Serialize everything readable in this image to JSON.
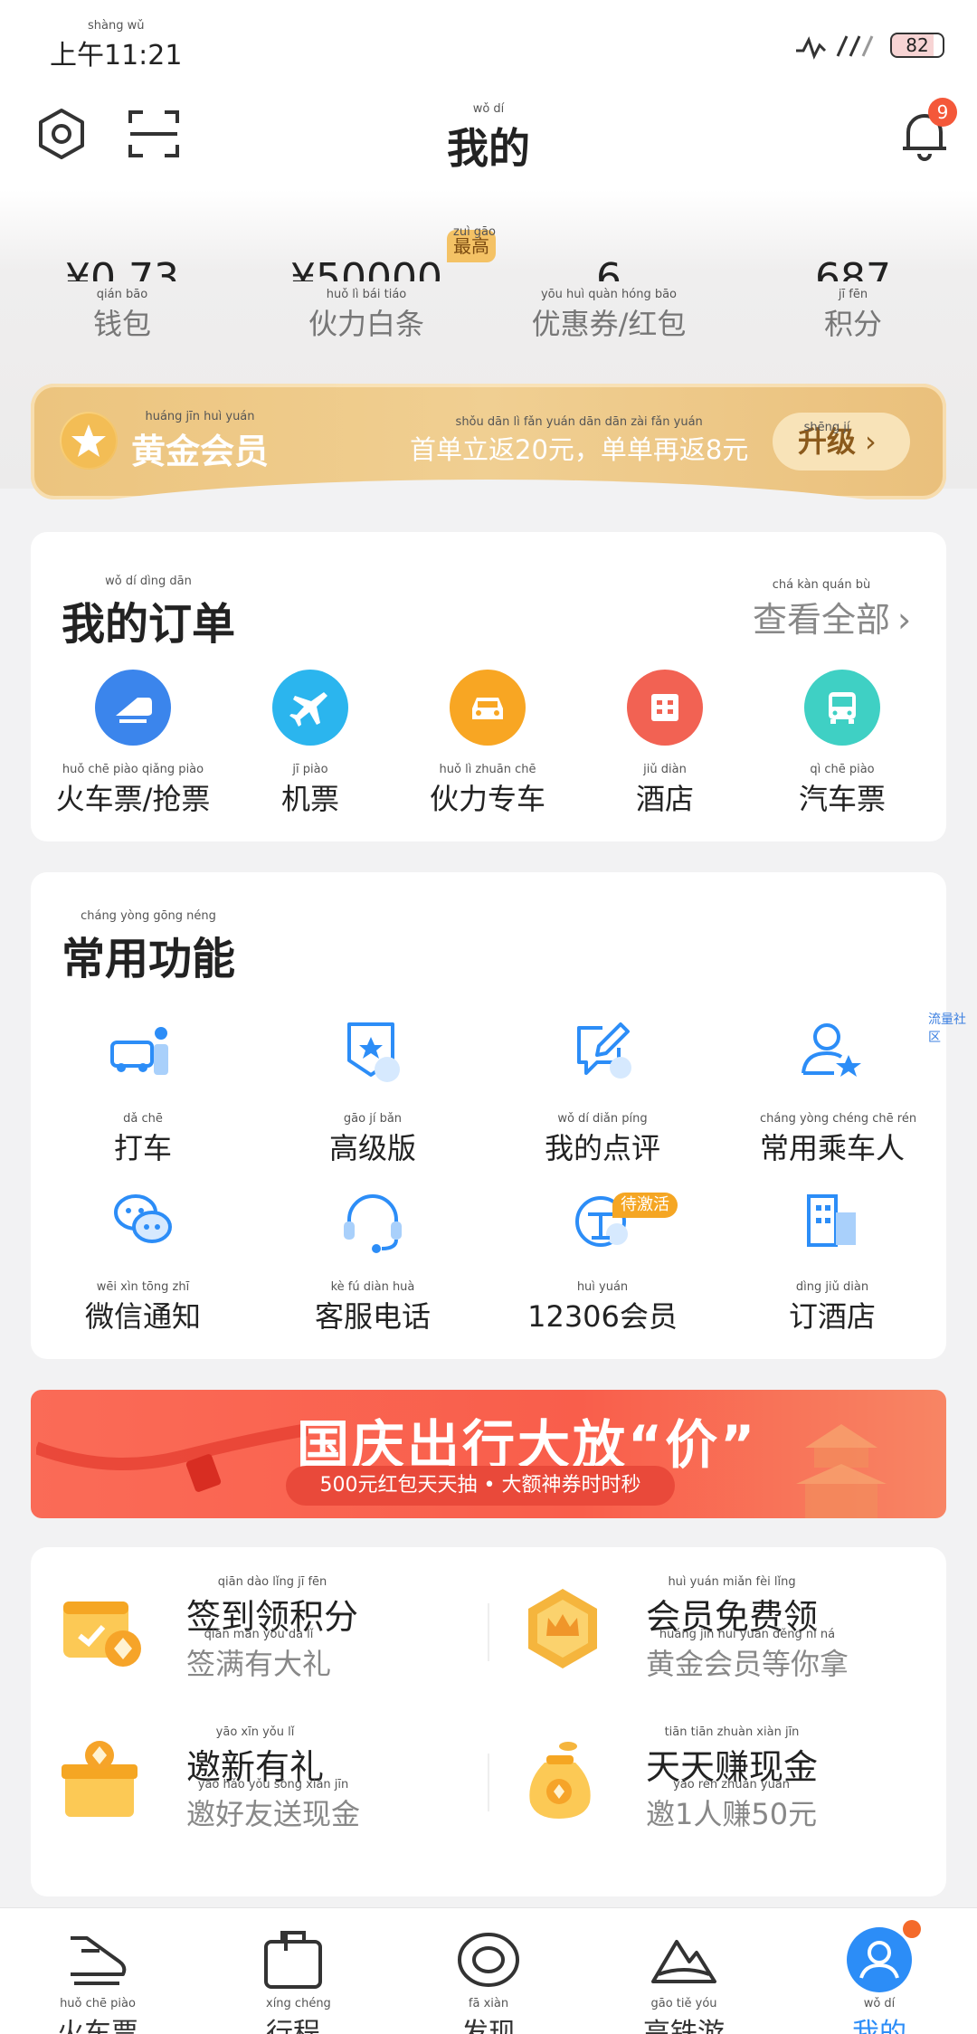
{
  "status_bar": {
    "time": "上午11:21",
    "time_py": "shàng wǔ",
    "battery": "82"
  },
  "header": {
    "title": "我的",
    "title_py": "wǒ dí",
    "notification_count": "9",
    "icons": [
      "settings-icon",
      "scan-icon",
      "bell-icon"
    ]
  },
  "stats": [
    {
      "value": "¥0.73",
      "label": "钱包",
      "py": "qián bāo"
    },
    {
      "value": "¥50000",
      "label": "伙力白条",
      "py": "huǒ lì bái tiáo",
      "tag": "最高",
      "tag_py": "zuì gāo"
    },
    {
      "value": "6",
      "label": "优惠券/红包",
      "py": "yōu huì quàn hóng bāo"
    },
    {
      "value": "687",
      "label": "积分",
      "py": "jī fēn"
    }
  ],
  "gold_member": {
    "title": "黄金会员",
    "title_py": "huáng jīn huì yuán",
    "promo": "首单立返20元，单单再返8元",
    "promo_py": "shǒu dān lì fǎn yuán dān dān zài fǎn yuán",
    "upgrade_label": "升级",
    "upgrade_py": "shēng jí"
  },
  "orders": {
    "title": "我的订单",
    "title_py": "wǒ dí dìng dān",
    "see_all": "查看全部",
    "see_all_py": "chá kàn quán bù",
    "items": [
      {
        "label": "火车票/抢票",
        "py": "huǒ chē piào qiǎng piào",
        "icon": "train-icon",
        "color": "#3b85ec"
      },
      {
        "label": "机票",
        "py": "jī piào",
        "icon": "plane-icon",
        "color": "#2bb5ee"
      },
      {
        "label": "伙力专车",
        "py": "huǒ lì zhuān chē",
        "icon": "car-icon",
        "color": "#f8a623"
      },
      {
        "label": "酒店",
        "py": "jiǔ diàn",
        "icon": "hotel-icon",
        "color": "#f26253"
      },
      {
        "label": "汽车票",
        "py": "qì chē piào",
        "icon": "bus-icon",
        "color": "#3fd0c4"
      }
    ]
  },
  "functions": {
    "title": "常用功能",
    "title_py": "cháng yòng gōng néng",
    "items": [
      {
        "label": "打车",
        "py": "dǎ chē",
        "icon": "taxi-icon"
      },
      {
        "label": "高级版",
        "py": "gāo jí bǎn",
        "icon": "premium-icon"
      },
      {
        "label": "我的点评",
        "py": "wǒ dí diǎn píng",
        "icon": "review-icon"
      },
      {
        "label": "常用乘车人",
        "py": "cháng yòng chéng chē rén",
        "icon": "passenger-icon"
      },
      {
        "label": "微信通知",
        "py": "wēi xìn tōng zhī",
        "icon": "wechat-icon"
      },
      {
        "label": "客服电话",
        "py": "kè fú diàn huà",
        "icon": "headset-icon"
      },
      {
        "label": "12306会员",
        "py": "huì yuán",
        "icon": "member-12306-icon"
      },
      {
        "label": "订酒店",
        "py": "dìng jiǔ diàn",
        "icon": "building-icon"
      }
    ],
    "pending_tag": "待激活",
    "side_tag": "流量社区"
  },
  "banner": {
    "title": "国庆出行大放“价”",
    "subtitle": "500元红包天天抽 • 大额神券时时秒"
  },
  "benefits": [
    {
      "title": "签到领积分",
      "title_py": "qiān dào lǐng jī fēn",
      "sub": "签满有大礼",
      "sub_py": "qiān mǎn yǒu dà lǐ",
      "icon": "calendar-coin-icon"
    },
    {
      "title": "会员免费领",
      "title_py": "huì yuán miǎn fèi lǐng",
      "sub": "黄金会员等你拿",
      "sub_py": "huáng jīn huì yuán děng nǐ ná",
      "icon": "crown-badge-icon"
    },
    {
      "title": "邀新有礼",
      "title_py": "yāo xīn yǒu lǐ",
      "sub": "邀好友送现金",
      "sub_py": "yāo hǎo yǒu sòng xiàn jīn",
      "icon": "gift-box-icon"
    },
    {
      "title": "天天赚现金",
      "title_py": "tiān tiān zhuàn xiàn jīn",
      "sub": "邀1人赚50元",
      "sub_py": "yāo rén zhuàn yuán",
      "icon": "money-bag-icon"
    }
  ],
  "tabbar": [
    {
      "label": "火车票",
      "py": "huǒ chē piào",
      "icon": "train-outline-icon"
    },
    {
      "label": "行程",
      "py": "xíng chéng",
      "icon": "briefcase-icon"
    },
    {
      "label": "发现",
      "py": "fā xiàn",
      "icon": "discover-icon"
    },
    {
      "label": "高铁游",
      "py": "gāo tiě yóu",
      "icon": "mountain-icon"
    },
    {
      "label": "我的",
      "py": "wǒ dí",
      "icon": "profile-icon",
      "active": true
    }
  ],
  "colors": {
    "accent": "#2c8df7",
    "gold": "#ecc47e",
    "banner": "#fa6b57",
    "badge": "#f4583a"
  }
}
